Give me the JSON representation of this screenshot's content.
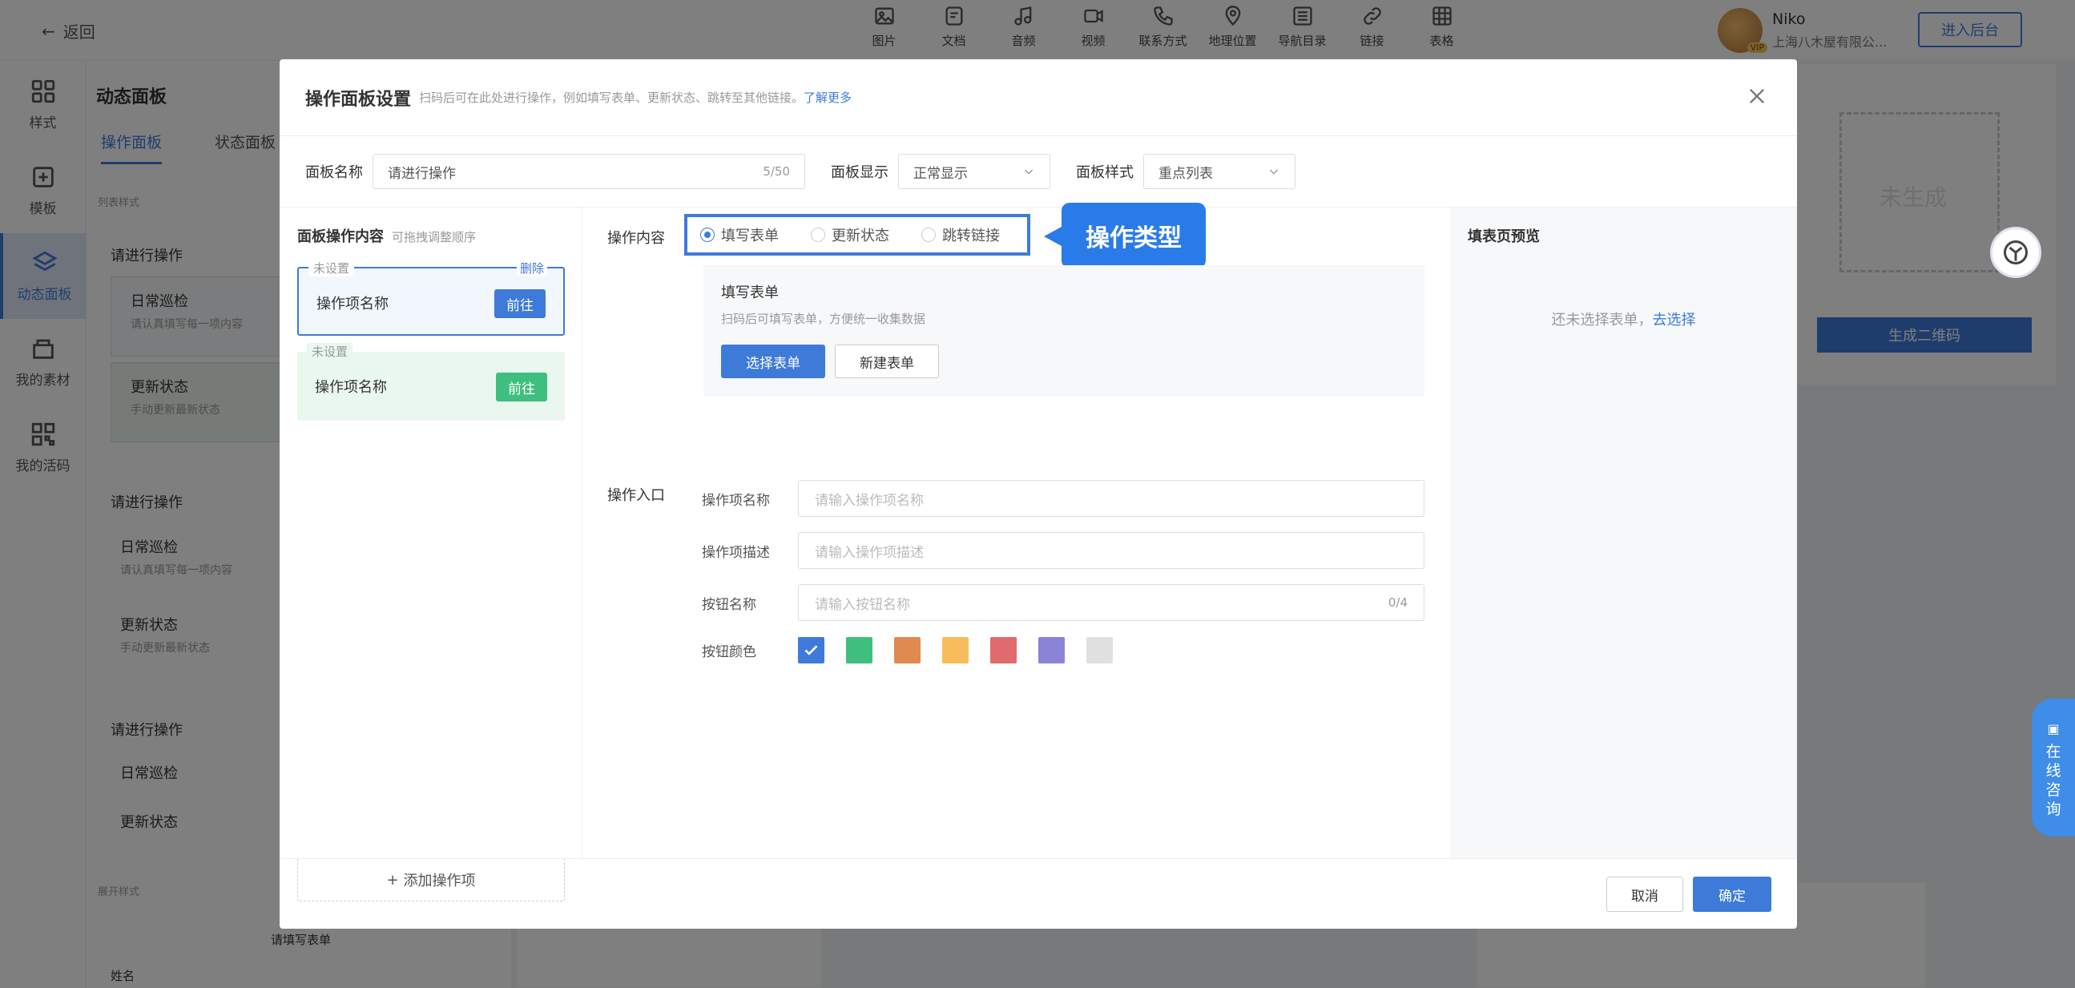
{
  "topbar": {
    "back_label": "返回",
    "tools": [
      {
        "icon": "image-icon",
        "label": "图片"
      },
      {
        "icon": "document-icon",
        "label": "文档"
      },
      {
        "icon": "music-icon",
        "label": "音频"
      },
      {
        "icon": "video-icon",
        "label": "视频"
      },
      {
        "icon": "phone-icon",
        "label": "联系方式"
      },
      {
        "icon": "location-icon",
        "label": "地理位置"
      },
      {
        "icon": "list-icon",
        "label": "导航目录"
      },
      {
        "icon": "link-icon",
        "label": "链接"
      },
      {
        "icon": "table-icon",
        "label": "表格"
      }
    ],
    "user_name": "Niko",
    "user_badge": "VIP",
    "user_company": "上海八木屋有限公...",
    "enter_backend": "进入后台"
  },
  "leftnav": [
    {
      "icon": "style-icon",
      "label": "样式",
      "active": false
    },
    {
      "icon": "template-icon",
      "label": "模板",
      "active": false
    },
    {
      "icon": "layers-icon",
      "label": "动态面板",
      "active": true
    },
    {
      "icon": "material-icon",
      "label": "我的素材",
      "active": false
    },
    {
      "icon": "qrcode-icon",
      "label": "我的活码",
      "active": false
    }
  ],
  "panel": {
    "title": "动态面板",
    "tabs": [
      "操作面板",
      "状态面板"
    ],
    "section_list_style": "列表样式",
    "group1_title": "请进行操作",
    "item1_title": "日常巡检",
    "item1_sub": "请认真填写每一项内容",
    "item2_title": "更新状态",
    "item2_sub": "手动更新最新状态",
    "group2_title": "请进行操作",
    "item3_title": "日常巡检",
    "item3_sub": "请认真填写每一项内容",
    "item4_title": "更新状态",
    "item4_sub": "手动更新最新状态",
    "group3_title": "请进行操作",
    "item5_title": "日常巡检",
    "item6_title": "更新状态",
    "section_expand_style": "展开样式",
    "bottom_text": "请填写表单",
    "bottom_text2": "姓名"
  },
  "preview": {
    "qr_status": "未生成",
    "generate_button": "生成二维码"
  },
  "modal": {
    "title": "操作面板设置",
    "hint": "扫码后可在此处进行操作，例如填写表单、更新状态、跳转至其他链接。",
    "hint_link": "了解更多",
    "panel_name_label": "面板名称",
    "panel_name_value": "请进行操作",
    "panel_name_count": "5/50",
    "panel_display_label": "面板显示",
    "panel_display_value": "正常显示",
    "panel_style_label": "面板样式",
    "panel_style_value": "重点列表",
    "left": {
      "header": "面板操作内容",
      "header_hint": "可拖拽调整顺序",
      "card1_tag": "未设置",
      "card1_name": "操作项名称",
      "card1_go": "前往",
      "card1_delete": "删除",
      "card2_tag": "未设置",
      "card2_name": "操作项名称",
      "card2_go": "前往",
      "add_label": "添加操作项"
    },
    "middle": {
      "content_label": "操作内容",
      "radio_options": [
        "填写表单",
        "更新状态",
        "跳转链接"
      ],
      "radio_selected": "填写表单",
      "callout": "操作类型",
      "form_title": "填写表单",
      "form_desc": "扫码后可填写表单，方便统一收集数据",
      "select_form": "选择表单",
      "new_form": "新建表单",
      "entry_label": "操作入口",
      "item_name_label": "操作项名称",
      "item_name_placeholder": "请输入操作项名称",
      "item_desc_label": "操作项描述",
      "item_desc_placeholder": "请输入操作项描述",
      "button_name_label": "按钮名称",
      "button_name_placeholder": "请输入按钮名称",
      "button_name_count": "0/4",
      "button_color_label": "按钮颜色",
      "colors": [
        "#3e7bd9",
        "#3fbf7f",
        "#e08a4f",
        "#f8bd5b",
        "#df6b6b",
        "#8b83d8",
        "#e0e0e0"
      ],
      "selected_color": "#3e7bd9"
    },
    "right": {
      "header": "填表页预览",
      "empty_text": "还未选择表单，",
      "empty_link": "去选择"
    },
    "cancel": "取消",
    "confirm": "确定"
  },
  "consult": [
    "在",
    "线",
    "咨",
    "询"
  ]
}
